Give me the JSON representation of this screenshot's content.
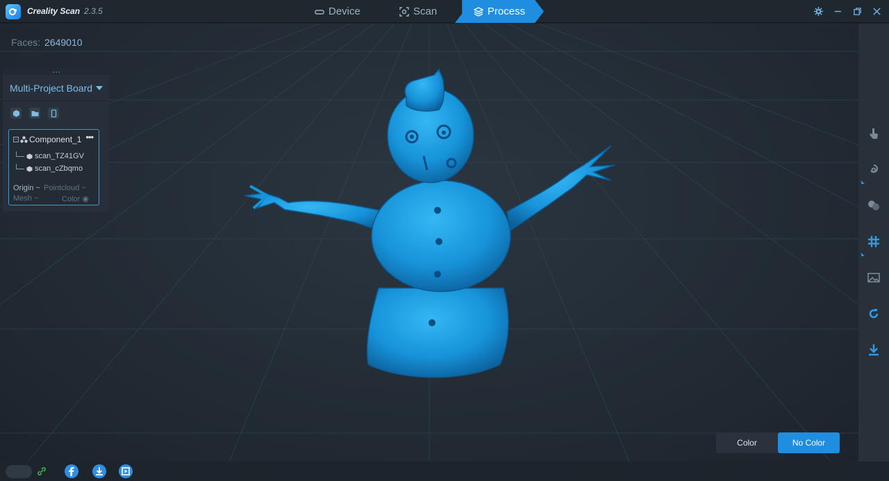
{
  "app": {
    "title": "Creality Scan",
    "version": "2.3.5"
  },
  "nav": {
    "tabs": [
      {
        "label": "Device",
        "icon": "device-icon",
        "active": false
      },
      {
        "label": "Scan",
        "icon": "scan-icon",
        "active": false
      },
      {
        "label": "Process",
        "icon": "layers-icon",
        "active": true
      }
    ]
  },
  "window_controls": [
    "settings-icon",
    "minimize-icon",
    "restore-icon",
    "close-icon"
  ],
  "viewport": {
    "faces_label": "Faces:",
    "faces_value": "2649010"
  },
  "panel": {
    "board_label": "Multi-Project Board",
    "tools": [
      "cube-icon",
      "folder-icon",
      "phone-icon"
    ],
    "component": {
      "name": "Component_1",
      "scans": [
        "scan_TZ41GV",
        "scan_cZbqmo"
      ],
      "toggles": {
        "origin": "Origin",
        "pointcloud": "Pointcloud",
        "mesh": "Mesh",
        "color": "Color"
      }
    }
  },
  "right_toolbar": [
    "touch-select-icon",
    "lasso-icon",
    "merge-icon",
    "grid-hash-icon",
    "image-icon",
    "refresh-icon",
    "download-icon"
  ],
  "color_toggle": {
    "color_label": "Color",
    "no_color_label": "No Color",
    "selected": "No Color"
  },
  "bottom": {
    "icons": [
      "facebook-icon",
      "download-icon",
      "video-icon"
    ]
  },
  "colors": {
    "accent": "#1f8ee0",
    "model": "#1a9be0",
    "background": "#1b222b"
  }
}
